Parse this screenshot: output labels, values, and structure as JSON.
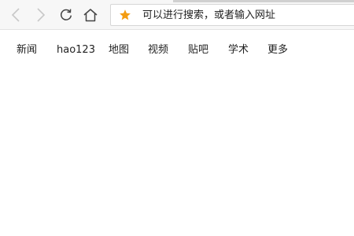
{
  "browser": {
    "address_placeholder": "可以进行搜索，或者输入网址",
    "star_color": "#f39c12"
  },
  "nav": {
    "items": [
      {
        "label": "新闻"
      },
      {
        "label": "hao123"
      },
      {
        "label": "地图"
      },
      {
        "label": "视频"
      },
      {
        "label": "贴吧"
      },
      {
        "label": "学术"
      },
      {
        "label": "更多"
      }
    ]
  }
}
